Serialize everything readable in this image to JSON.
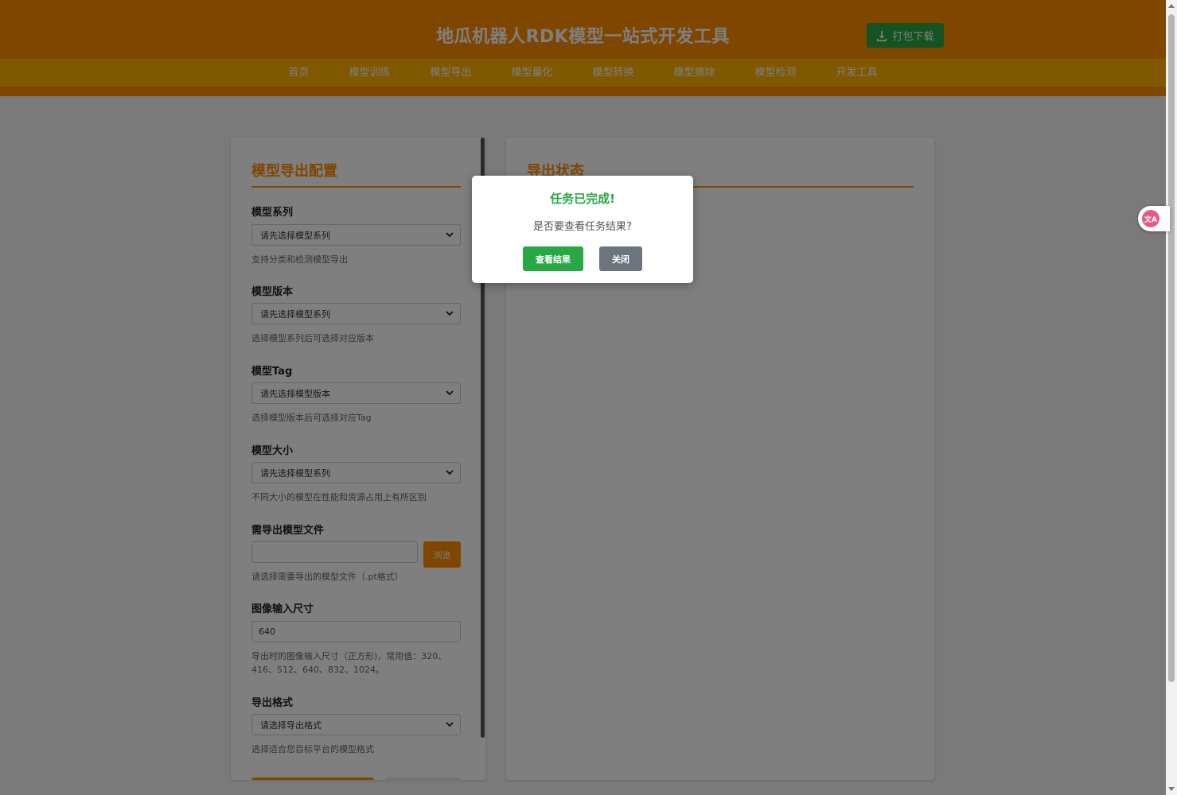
{
  "header": {
    "title": "地瓜机器人RDK模型一站式开发工具",
    "pack_download": "打包下载"
  },
  "nav": [
    "首页",
    "模型训练",
    "模型导出",
    "模型量化",
    "模型转换",
    "模型摘除",
    "模型检测",
    "开发工具"
  ],
  "config": {
    "title": "模型导出配置",
    "series_label": "模型系列",
    "series_value": "请先选择模型系列",
    "series_hint": "支持分类和检测模型导出",
    "version_label": "模型版本",
    "version_value": "请先选择模型系列",
    "version_hint": "选择模型系列后可选择对应版本",
    "tag_label": "模型Tag",
    "tag_value": "请先选择模型版本",
    "tag_hint": "选择模型版本后可选择对应Tag",
    "size_label": "模型大小",
    "size_value": "请先选择模型系列",
    "size_hint": "不同大小的模型在性能和资源占用上有所区别",
    "file_label": "需导出模型文件",
    "file_value": "",
    "browse": "浏览",
    "file_hint": "请选择需要导出的模型文件（.pt格式）",
    "imgsz_label": "图像输入尺寸",
    "imgsz_value": "640",
    "imgsz_hint": "导出时的图像输入尺寸（正方形)，常用值：320、416、512、640、832、1024。",
    "format_label": "导出格式",
    "format_value": "请选择导出格式",
    "format_hint": "选择适合您目标平台的模型格式"
  },
  "status": {
    "title": "导出状态"
  },
  "modal": {
    "title": "任务已完成!",
    "message": "是否要查看任务结果?",
    "view_result": "查看结果",
    "close": "关闭"
  },
  "translate_widget": {
    "icon": "translate-icon"
  },
  "colors": {
    "brand": "#ff8c00",
    "nav": "#ffb000",
    "success": "#28a745",
    "secondary": "#6c757d"
  }
}
